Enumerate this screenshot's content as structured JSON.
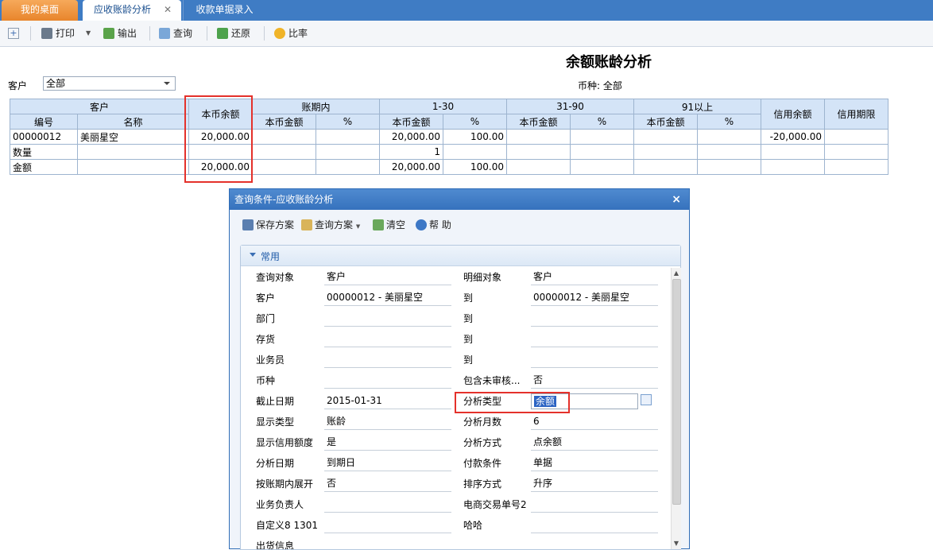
{
  "tabs": [
    {
      "label": "我的桌面"
    },
    {
      "label": "应收账龄分析",
      "close": "✕"
    },
    {
      "label": "收款单据录入"
    }
  ],
  "toolbar": {
    "new_icon": "add-icon",
    "print": "打印",
    "export": "输出",
    "query": "查询",
    "restore": "还原",
    "ratio": "比率"
  },
  "report": {
    "title": "余额账龄分析",
    "customer_label": "客户",
    "customer_value": "全部",
    "currency_text": "币种: 全部"
  },
  "grid": {
    "group_headers": {
      "customer": "客户",
      "local_balance": "本币余额",
      "within_period": "账期内",
      "range_1_30": "1-30",
      "range_31_90": "31-90",
      "range_91_plus": "91以上",
      "credit_balance": "信用余额",
      "credit_period": "信用期限"
    },
    "sub_headers": {
      "code": "编号",
      "name": "名称",
      "local_amount": "本币金额",
      "percent": "%"
    },
    "rows": [
      [
        "00000012",
        "美丽星空",
        "20,000.00",
        "",
        "",
        "20,000.00",
        "100.00",
        "",
        "",
        "",
        "",
        "-20,000.00",
        ""
      ],
      [
        "数量",
        "",
        "",
        "",
        "",
        "1",
        "",
        "",
        "",
        "",
        "",
        "",
        ""
      ],
      [
        "金额",
        "",
        "20,000.00",
        "",
        "",
        "20,000.00",
        "100.00",
        "",
        "",
        "",
        "",
        "",
        ""
      ]
    ]
  },
  "dialog": {
    "title": "查询条件-应收账龄分析",
    "close": "×",
    "tools": {
      "save_plan": "保存方案",
      "query_plan": "查询方案",
      "clear": "清空",
      "help": "帮 助"
    },
    "section": "常用",
    "left_fields": [
      {
        "label": "查询对象",
        "value": "客户"
      },
      {
        "label": "客户",
        "value": "00000012 - 美丽星空"
      },
      {
        "label": "部门",
        "value": ""
      },
      {
        "label": "存货",
        "value": ""
      },
      {
        "label": "业务员",
        "value": ""
      },
      {
        "label": "币种",
        "value": ""
      },
      {
        "label": "截止日期",
        "value": "2015-01-31"
      },
      {
        "label": "显示类型",
        "value": "账龄"
      },
      {
        "label": "显示信用额度",
        "value": "是"
      },
      {
        "label": "分析日期",
        "value": "到期日"
      },
      {
        "label": "按账期内展开",
        "value": "否"
      },
      {
        "label": "业务负责人",
        "value": ""
      },
      {
        "label": "自定义8 1301",
        "value": ""
      },
      {
        "label": "出货信息",
        "value": ""
      }
    ],
    "right_fields": [
      {
        "label": "明细对象",
        "value": "客户"
      },
      {
        "label": "到",
        "value": "00000012 - 美丽星空"
      },
      {
        "label": "到",
        "value": ""
      },
      {
        "label": "到",
        "value": ""
      },
      {
        "label": "到",
        "value": ""
      },
      {
        "label": "包含未审核...",
        "value": "否"
      },
      {
        "label": "分析类型",
        "value": "余额"
      },
      {
        "label": "分析月数",
        "value": "6"
      },
      {
        "label": "分析方式",
        "value": "点余额"
      },
      {
        "label": "付款条件",
        "value": "单据"
      },
      {
        "label": "排序方式",
        "value": "升序"
      },
      {
        "label": "电商交易单号2",
        "value": ""
      },
      {
        "label": "哈哈",
        "value": ""
      }
    ],
    "scroll": {
      "up": "▲",
      "down": "▼"
    }
  },
  "colors": {
    "tab_bar": "#3f7cc4",
    "active_tab_orange": "#e8852c",
    "highlight_red": "#e4312b",
    "selection_blue": "#2b63c3"
  }
}
